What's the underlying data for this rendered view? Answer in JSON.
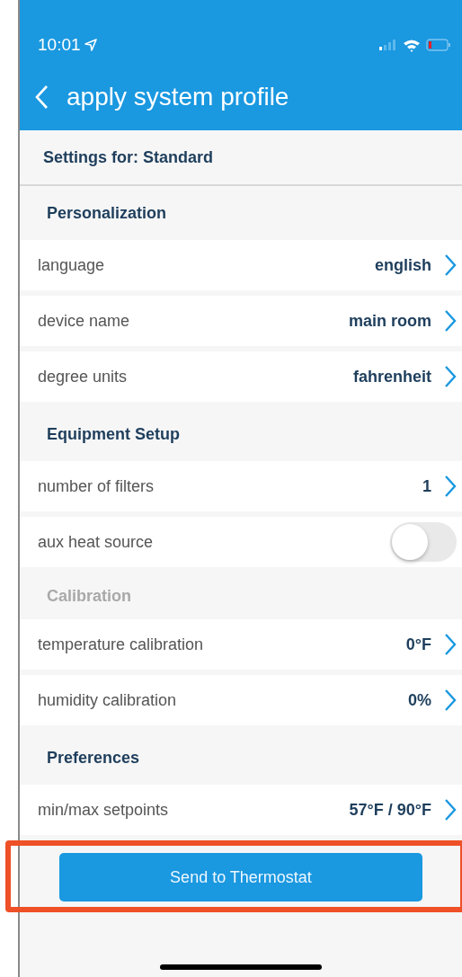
{
  "status_bar": {
    "time": "10:01"
  },
  "header": {
    "title": "apply system profile"
  },
  "subheader": "Settings for: Standard",
  "sections": [
    {
      "title": "Personalization",
      "disabled": false,
      "rows": [
        {
          "kind": "value",
          "label": "language",
          "value": "english"
        },
        {
          "kind": "value",
          "label": "device name",
          "value": "main room"
        },
        {
          "kind": "value",
          "label": "degree units",
          "value": "fahrenheit"
        }
      ]
    },
    {
      "title": "Equipment Setup",
      "disabled": false,
      "rows": [
        {
          "kind": "value",
          "label": "number of filters",
          "value": "1"
        },
        {
          "kind": "toggle",
          "label": "aux heat source",
          "on": false
        }
      ]
    },
    {
      "title": "Calibration",
      "disabled": true,
      "rows": [
        {
          "kind": "value",
          "label": "temperature calibration",
          "value": "0°F"
        },
        {
          "kind": "value",
          "label": "humidity calibration",
          "value": "0%"
        }
      ]
    },
    {
      "title": "Preferences",
      "disabled": false,
      "rows": [
        {
          "kind": "value",
          "label": "min/max setpoints",
          "value": "57°F  / 90°F"
        }
      ]
    }
  ],
  "action_button": "Send to Thermostat"
}
